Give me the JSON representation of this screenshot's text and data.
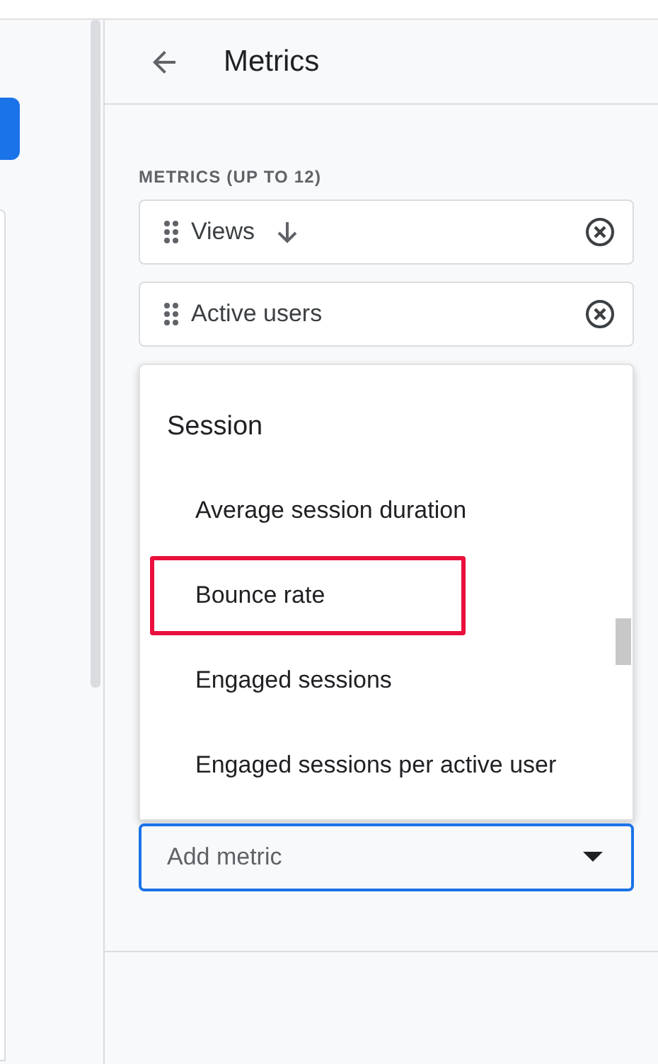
{
  "panel": {
    "title": "Metrics"
  },
  "section_label": "METRICS (UP TO 12)",
  "metrics": [
    {
      "name": "Views",
      "sorted": true
    },
    {
      "name": "Active users",
      "sorted": false
    }
  ],
  "menu": {
    "group": "Session",
    "items": [
      {
        "label": "Average session duration",
        "highlighted": false
      },
      {
        "label": "Bounce rate",
        "highlighted": true
      },
      {
        "label": "Engaged sessions",
        "highlighted": false
      },
      {
        "label": "Engaged sessions per active user",
        "highlighted": false
      }
    ]
  },
  "add_field": {
    "placeholder": "Add metric"
  }
}
